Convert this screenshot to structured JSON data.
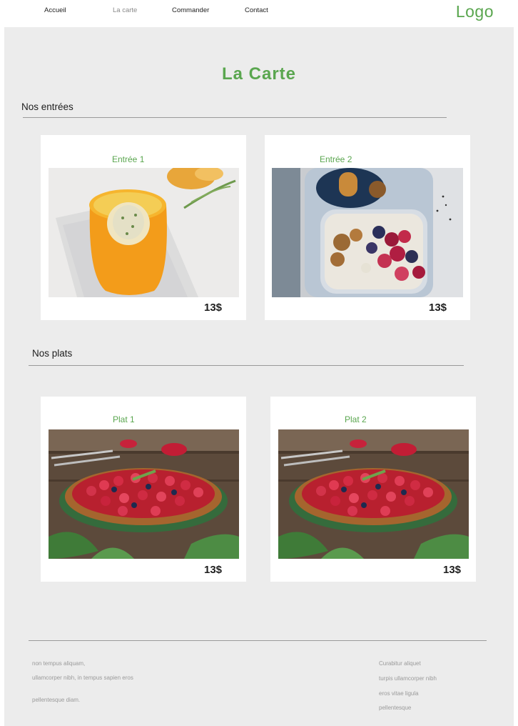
{
  "nav": {
    "items": [
      {
        "label": "Accueil"
      },
      {
        "label": "La carte"
      },
      {
        "label": "Commander"
      },
      {
        "label": "Contact"
      }
    ],
    "logo": "Logo"
  },
  "page": {
    "title": "La Carte"
  },
  "sections": {
    "entrees": {
      "title": "Nos entrées",
      "items": [
        {
          "name": "Entrée 1",
          "price": "13$",
          "image": "orange-cup-dish"
        },
        {
          "name": "Entrée 2",
          "price": "13$",
          "image": "berry-oatmeal-bowl"
        }
      ]
    },
    "plats": {
      "title": "Nos plats",
      "items": [
        {
          "name": "Plat 1",
          "price": "13$",
          "image": "berry-tart"
        },
        {
          "name": "Plat 2",
          "price": "13$",
          "image": "berry-tart"
        }
      ]
    }
  },
  "footer": {
    "left": [
      "non tempus aliquam,",
      "ullamcorper nibh, in tempus sapien eros",
      "pellentesque diam."
    ],
    "right": [
      "Curabitur aliquet",
      "turpis ullamcorper nibh",
      "eros vitae ligula",
      "pellentesque"
    ]
  },
  "colors": {
    "accent": "#5aa64f",
    "background": "#ececec",
    "text": "#1e1e1e"
  }
}
